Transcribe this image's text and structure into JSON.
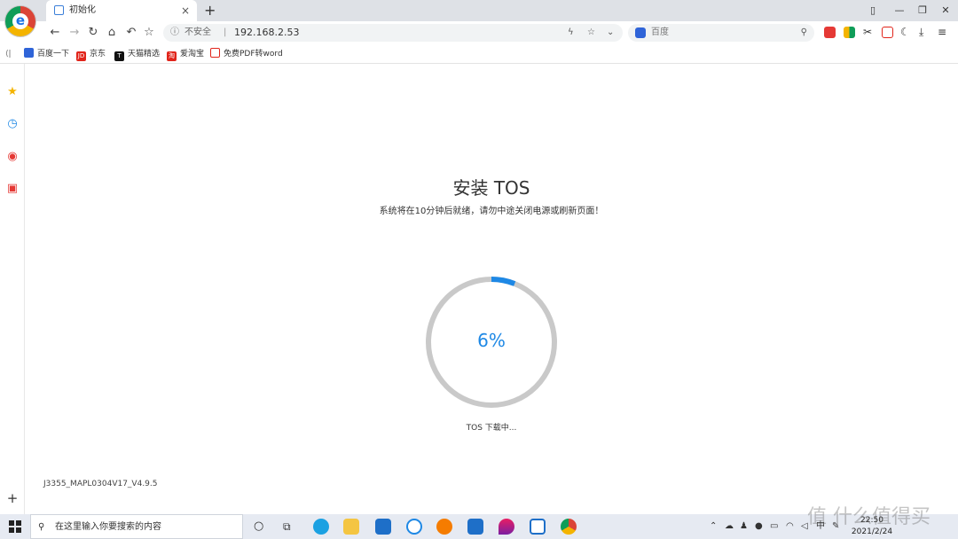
{
  "browser": {
    "tab_title": "初始化",
    "tab_close": "×",
    "new_tab": "+",
    "address": {
      "security_label": "不安全",
      "separator": "|",
      "url": "192.168.2.53"
    },
    "search": {
      "placeholder": "百度"
    },
    "bookmarks": [
      {
        "label": "百度一下",
        "color": "#2f64d8"
      },
      {
        "label": "京东",
        "color": "#e1251b",
        "badge": "JD"
      },
      {
        "label": "天猫精选",
        "color": "#111111",
        "badge": "T"
      },
      {
        "label": "爱淘宝",
        "color": "#e1251b",
        "badge": "淘"
      },
      {
        "label": "免费PDF转word",
        "color": "#e1251b"
      }
    ]
  },
  "install": {
    "title": "安装 TOS",
    "subtitle": "系统将在10分钟后就绪，请勿中途关闭电源或刷新页面！",
    "progress_percent": 6,
    "progress_label": "6%",
    "status": "TOS 下载中...",
    "version": "J3355_MAPL0304V17_V4.9.5",
    "ring_color": "#c9c9c9",
    "progress_color": "#1e88e5"
  },
  "taskbar": {
    "search_placeholder": "在这里输入你要搜索的内容",
    "time": "22:50",
    "date": "2021/2/24"
  },
  "watermark": "值 什么值得买"
}
